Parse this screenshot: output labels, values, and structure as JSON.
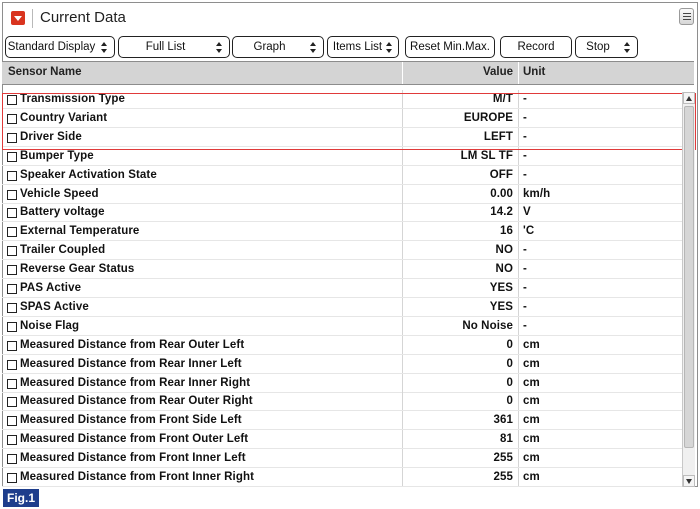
{
  "window": {
    "title": "Current Data"
  },
  "toolbar": {
    "buttons": [
      {
        "label": "Standard Display",
        "has_spinner": true
      },
      {
        "label": "Full List",
        "has_spinner": true
      },
      {
        "label": "Graph",
        "has_spinner": true
      },
      {
        "label": "Items List",
        "has_spinner": true
      },
      {
        "label": "Reset Min.Max.",
        "has_spinner": false
      },
      {
        "label": "Record",
        "has_spinner": false
      },
      {
        "label": "Stop",
        "has_spinner": true
      }
    ]
  },
  "table": {
    "columns": {
      "name": "Sensor Name",
      "value": "Value",
      "unit": "Unit"
    },
    "rows": [
      {
        "name": "Transmission Type",
        "value": "M/T",
        "unit": "-"
      },
      {
        "name": "Country Variant",
        "value": "EUROPE",
        "unit": "-"
      },
      {
        "name": "Driver Side",
        "value": "LEFT",
        "unit": "-"
      },
      {
        "name": "Bumper Type",
        "value": "LM SL TF",
        "unit": "-"
      },
      {
        "name": "Speaker Activation State",
        "value": "OFF",
        "unit": "-"
      },
      {
        "name": "Vehicle Speed",
        "value": "0.00",
        "unit": "km/h"
      },
      {
        "name": "Battery voltage",
        "value": "14.2",
        "unit": "V"
      },
      {
        "name": "External Temperature",
        "value": "16",
        "unit": "'C"
      },
      {
        "name": "Trailer Coupled",
        "value": "NO",
        "unit": "-"
      },
      {
        "name": "Reverse Gear Status",
        "value": "NO",
        "unit": "-"
      },
      {
        "name": "PAS Active",
        "value": "YES",
        "unit": "-"
      },
      {
        "name": "SPAS Active",
        "value": "YES",
        "unit": "-"
      },
      {
        "name": "Noise Flag",
        "value": "No Noise",
        "unit": "-"
      },
      {
        "name": "Measured Distance from Rear Outer Left",
        "value": "0",
        "unit": "cm"
      },
      {
        "name": "Measured Distance from Rear Inner Left",
        "value": "0",
        "unit": "cm"
      },
      {
        "name": "Measured Distance from Rear Inner Right",
        "value": "0",
        "unit": "cm"
      },
      {
        "name": "Measured Distance from Rear Outer Right",
        "value": "0",
        "unit": "cm"
      },
      {
        "name": "Measured Distance from Front Side Left",
        "value": "361",
        "unit": "cm"
      },
      {
        "name": "Measured Distance from Front Outer Left",
        "value": "81",
        "unit": "cm"
      },
      {
        "name": "Measured Distance from Front Inner Left",
        "value": "255",
        "unit": "cm"
      },
      {
        "name": "Measured Distance from Front Inner Right",
        "value": "255",
        "unit": "cm"
      }
    ]
  },
  "figure_label": "Fig.1",
  "colors": {
    "title_icon": "#d9341f",
    "highlight": "#e03a3a",
    "header_bg": "#d4d4d4",
    "fig_label_bg": "#1e3d8c"
  },
  "icons": {
    "title": "collapse-arrow-icon",
    "menu": "menu-list-icon"
  }
}
